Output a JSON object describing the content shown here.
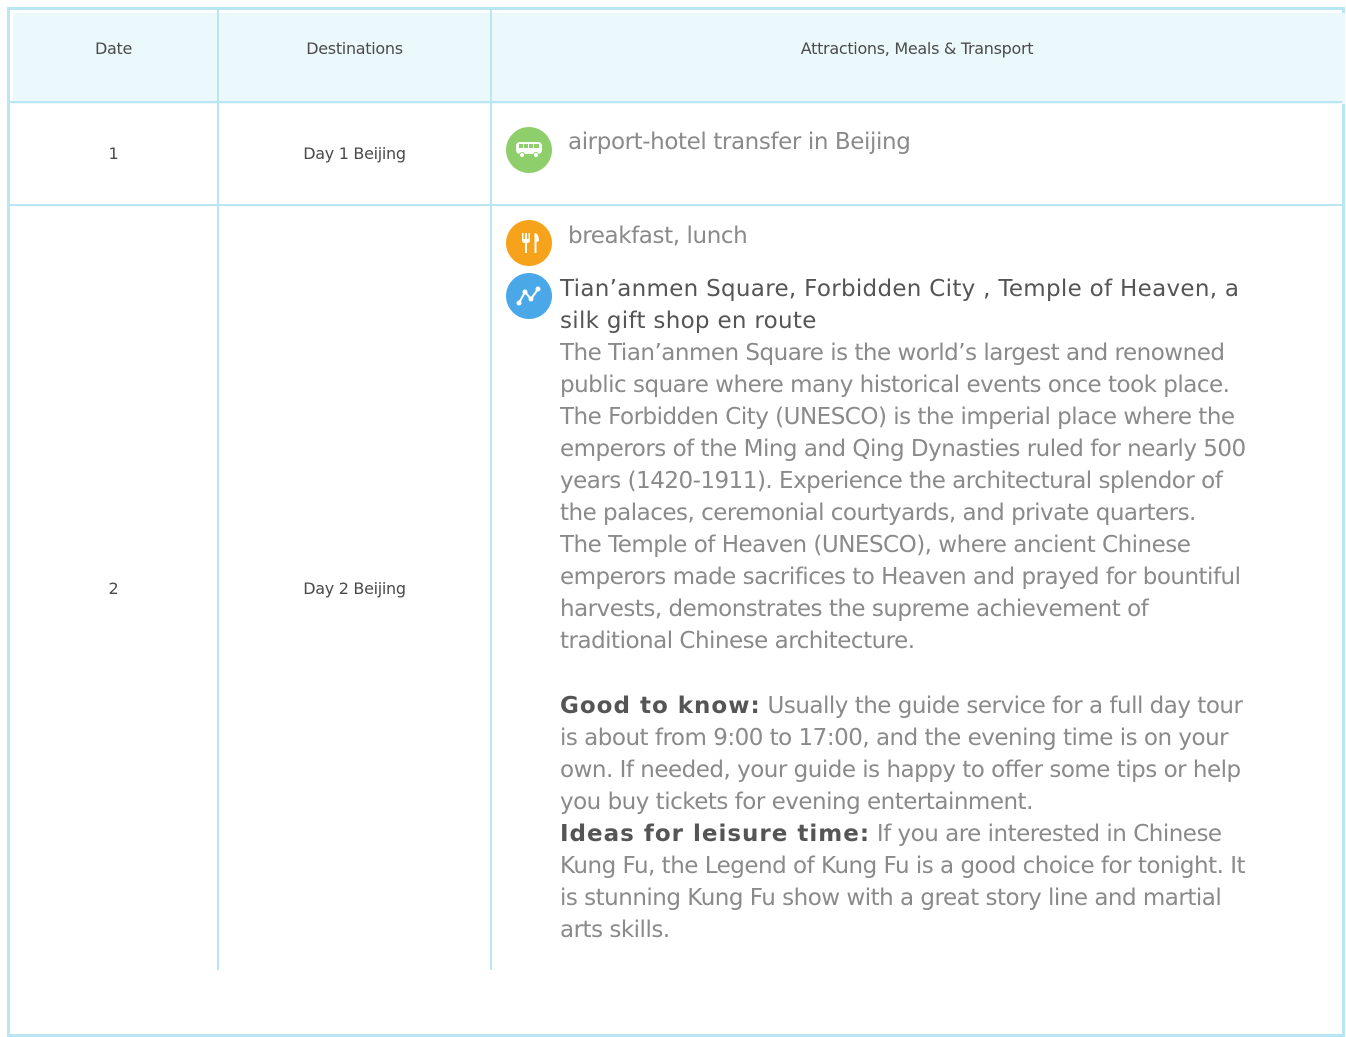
{
  "table": {
    "headers": {
      "date": "Date",
      "destinations": "Destinations",
      "attractions": "Attractions, Meals & Transport"
    },
    "rows": [
      {
        "date": "1",
        "destination": "Day 1 Beijing",
        "transport": "airport-hotel transfer in Beijing",
        "transport_icon": "bus-icon"
      },
      {
        "date": "2",
        "destination": "Day 2 Beijing",
        "meals": "breakfast, lunch",
        "meals_icon": "fork-knife-icon",
        "attractions_icon": "route-icon",
        "attractions_title": "Tian’anmen Square, Forbidden City , Temple of Heaven, a silk gift shop en route",
        "desc1": "The Tian’anmen Square is the world’s largest and renowned public square where many historical events once took place.",
        "desc2": "The Forbidden City (UNESCO) is the imperial place where the emperors of the Ming and Qing Dynasties ruled for nearly 500 years (1420-1911). Experience the architectural splendor of the palaces, ceremonial courtyards, and private quarters.",
        "desc3": "The Temple of Heaven (UNESCO), where ancient Chinese emperors made sacrifices to Heaven and prayed for bountiful harvests, demonstrates the supreme achievement of traditional Chinese architecture.",
        "good_to_know_label": "Good to know:",
        "good_to_know_text": " Usually the guide service for a full day tour is about from 9:00 to 17:00, and the evening time is on your own. If needed, your guide is happy to offer some tips or help you buy tickets for evening entertainment.",
        "leisure_label": "Ideas for leisure time:",
        "leisure_text": " If you are interested in Chinese Kung Fu, the Legend of Kung Fu is a good choice for tonight. It is stunning Kung Fu show with a great story line and martial arts skills."
      }
    ]
  },
  "colors": {
    "border": "#b8e6f2",
    "header_bg": "#ecf9fc",
    "icon_green": "#8fcf6b",
    "icon_orange": "#f7a21b",
    "icon_blue": "#4aa8e8"
  }
}
